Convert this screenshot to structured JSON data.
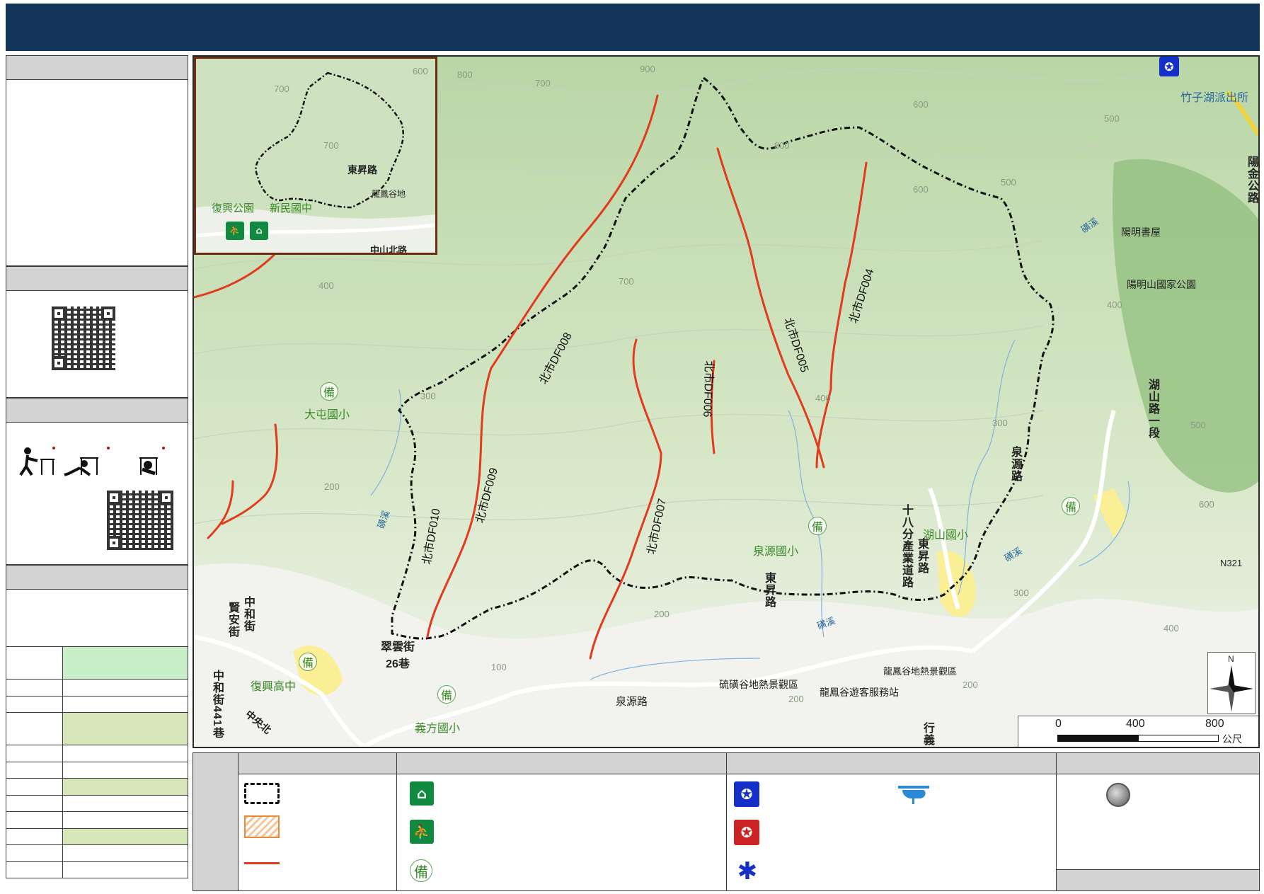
{
  "map": {
    "places": {
      "datun_school": "大屯國小",
      "fuxing_high": "復興高中",
      "yifang_school": "義方國小",
      "quanyuan_school": "泉源國小",
      "hushan_school": "湖山國小",
      "yangming_study": "陽明書屋",
      "yangmingshan_park": "陽明山國家公園",
      "zhuzihu_police": "竹子湖派出所",
      "liuhuang_valley": "硫磺谷地熱景觀區",
      "longfeng_service": "龍鳳谷遊客服務站",
      "longfeng_valley": "龍鳳谷地熱景觀區",
      "n321": "N321",
      "inset_fuxing_park": "復興公園",
      "inset_xinmin_school": "新民國中",
      "inset_longfeng": "龍鳳谷地"
    },
    "roads": {
      "dongsheng_inset": "東昇路",
      "zhongshan_north": "中山北路",
      "dongsheng_1": "東昇路",
      "dongsheng_2": "東昇路",
      "industry_road": "十八分產業道路",
      "quanyuan_road": "泉源路",
      "quanyuan_road_2": "泉源路",
      "hushan_road": "湖山路一段",
      "yangjin_road": "陽金公路",
      "cuiyun": "翠雲街26巷",
      "zhonghe": "中和街",
      "xian_st": "賢安街",
      "zhonghe_441": "中和街441巷",
      "zhongyang": "中央北",
      "xingyi": "行義",
      "creek_1": "磺溪",
      "creek_2": "磺溪",
      "creek_3": "磺溪",
      "creek_4": "磺溪"
    },
    "torrents": {
      "df004": "北市DF004",
      "df005": "北市DF005",
      "df006": "北市DF006",
      "df007": "北市DF007",
      "df008": "北市DF008",
      "df009": "北市DF009",
      "df010": "北市DF010"
    },
    "contours": [
      "700",
      "800",
      "900",
      "600",
      "500",
      "400",
      "300",
      "200",
      "100",
      "600",
      "700",
      "800",
      "600",
      "500",
      "400",
      "300",
      "200",
      "400",
      "500",
      "600",
      "700",
      "400",
      "300",
      "200",
      "200"
    ],
    "shelter_mark": "備",
    "scale": {
      "ticks": [
        "0",
        "400",
        "800"
      ],
      "unit": "公尺"
    },
    "north": "N"
  },
  "icons": {
    "shelter": "shelter-icon",
    "evacuation": "evacuation-icon",
    "police": "police-icon",
    "fire": "fire-station-icon",
    "medical": "medical-icon",
    "helicopter": "helicopter-icon",
    "gauge": "rain-gauge-icon"
  },
  "colors": {
    "header": "#123559",
    "torrent": "#e23a1c",
    "boundary": "#111111",
    "status_green": "#c9efc9",
    "status_olive": "#d6e6b8"
  }
}
